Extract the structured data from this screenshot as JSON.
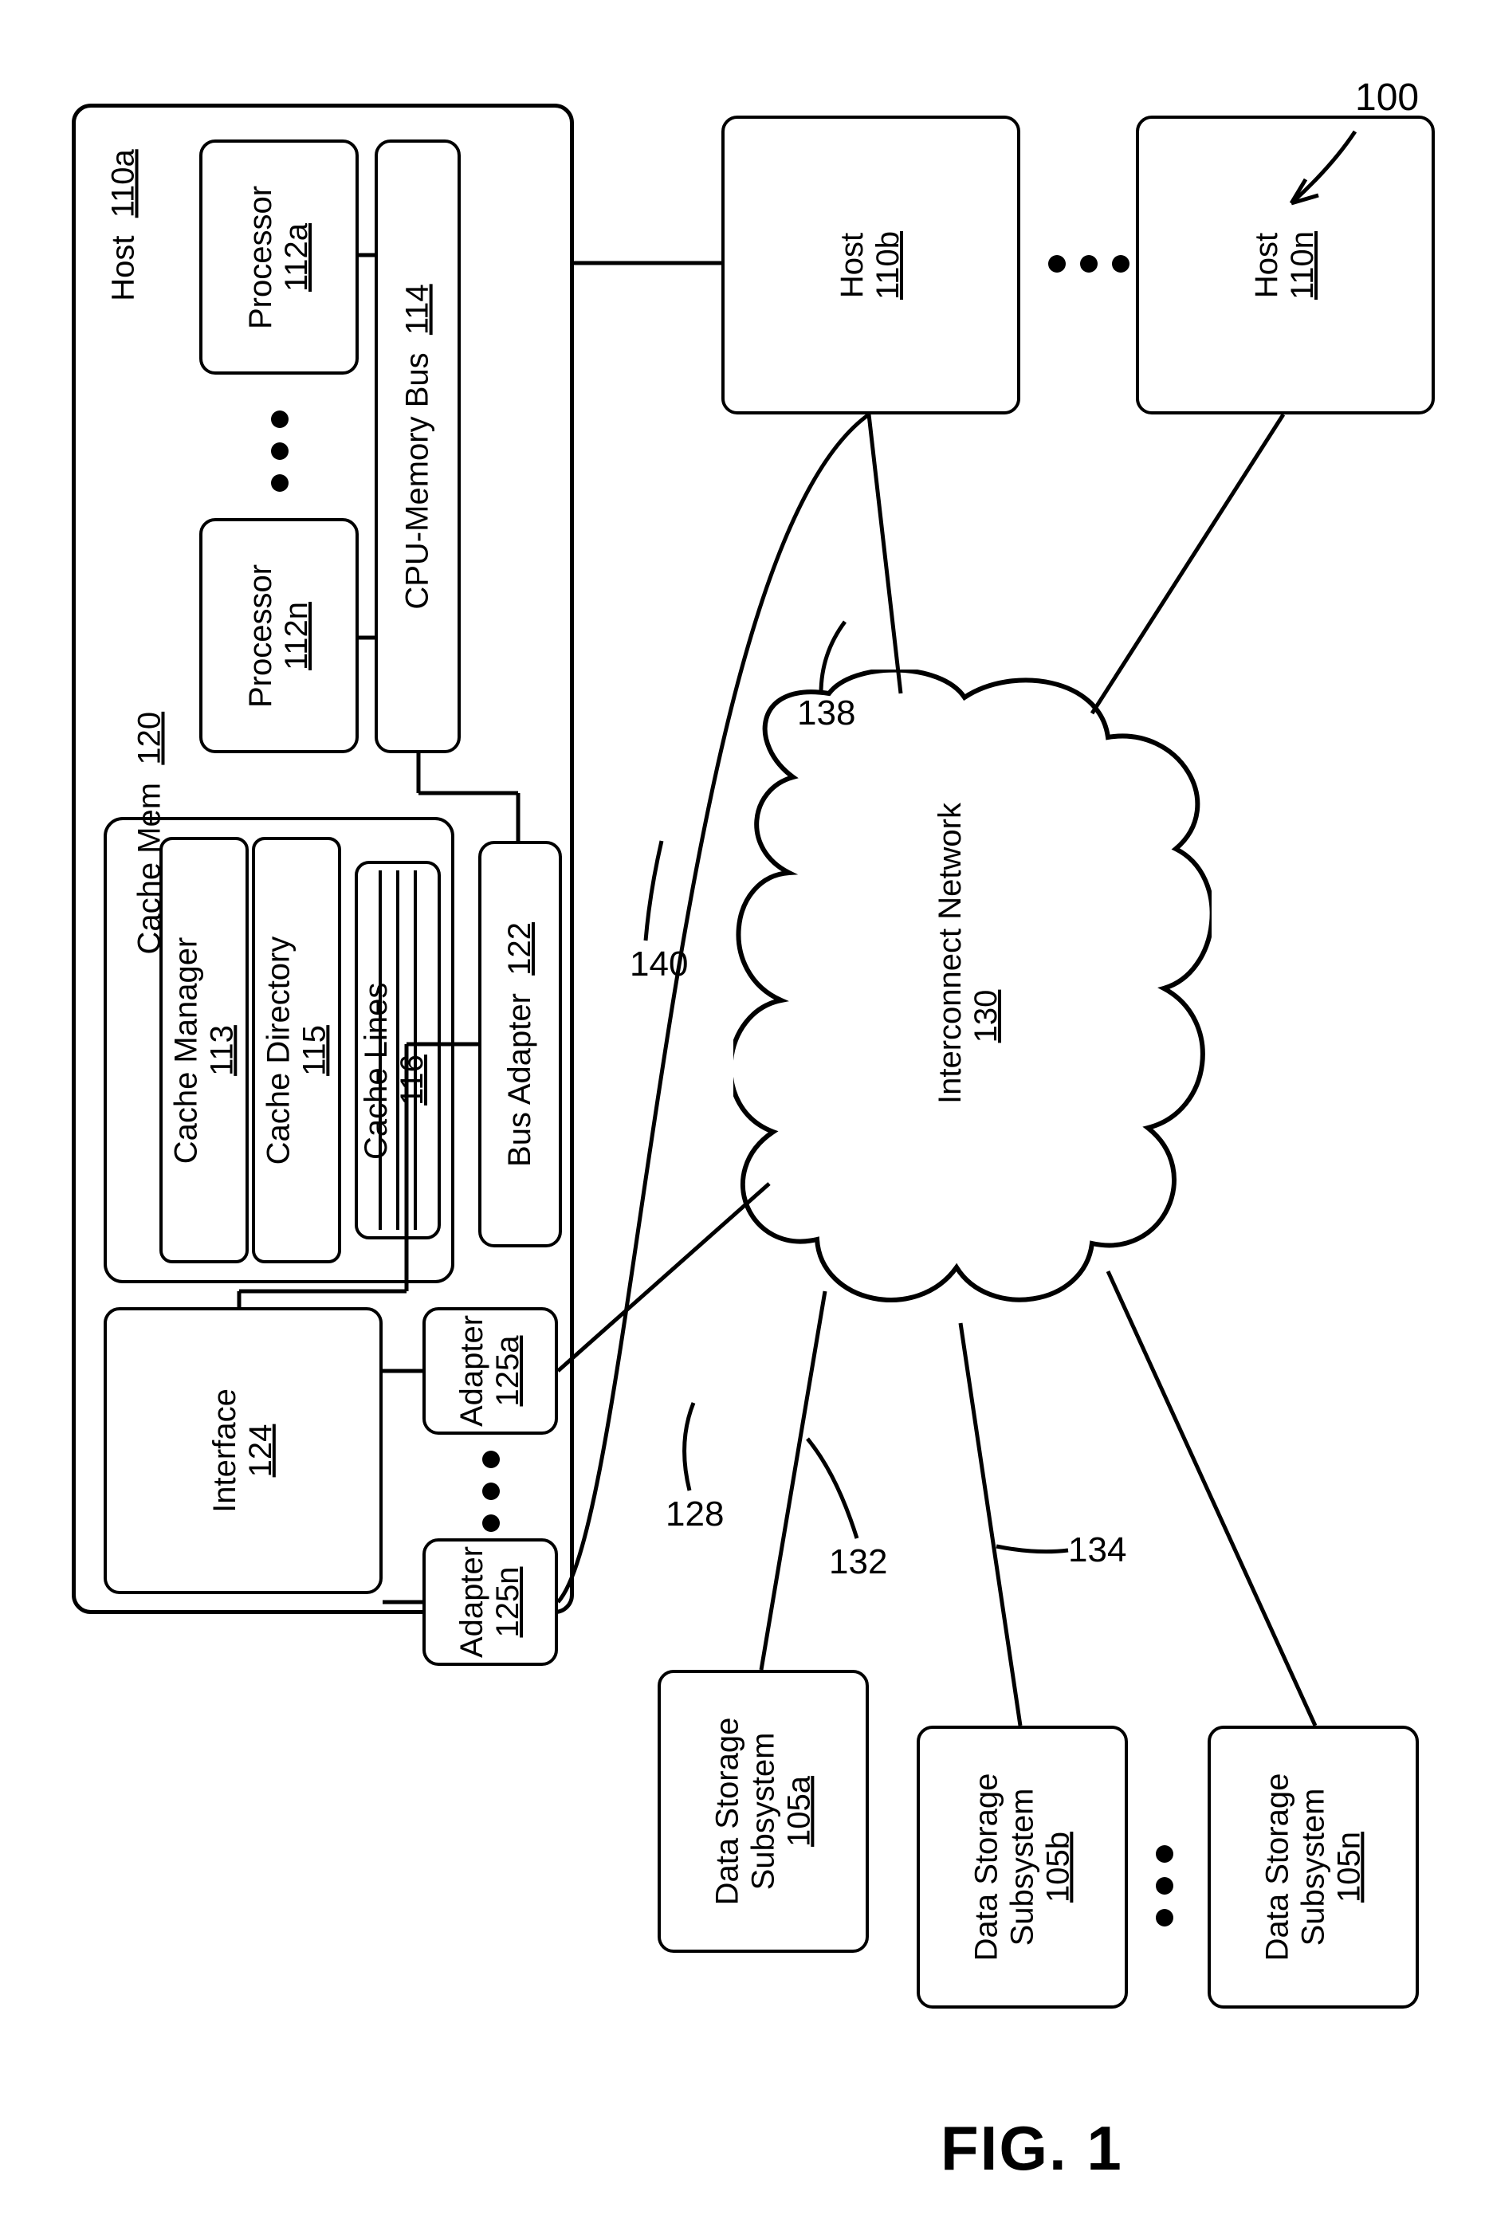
{
  "figure": {
    "caption": "FIG. 1",
    "ref": "100"
  },
  "host_detail": {
    "title": "Host",
    "id": "110a",
    "processor_a": {
      "label": "Processor",
      "id": "112a"
    },
    "processor_n": {
      "label": "Processor",
      "id": "112n"
    },
    "bus": {
      "label": "CPU-Memory Bus",
      "id": "114"
    },
    "cache_mem": {
      "label": "Cache Mem",
      "id": "120"
    },
    "cache_manager": {
      "label": "Cache Manager",
      "id": "113"
    },
    "cache_directory": {
      "label": "Cache Directory",
      "id": "115"
    },
    "cache_lines": {
      "label": "Cache Lines",
      "id": "116"
    },
    "bus_adapter": {
      "label": "Bus Adapter",
      "id": "122"
    },
    "interface": {
      "label": "Interface",
      "id": "124"
    },
    "adapter_a": {
      "label": "Adapter",
      "id": "125a"
    },
    "adapter_n": {
      "label": "Adapter",
      "id": "125n"
    }
  },
  "hosts": {
    "b": {
      "label": "Host",
      "id": "110b"
    },
    "n": {
      "label": "Host",
      "id": "110n"
    }
  },
  "network": {
    "label": "Interconnect Network",
    "id": "130"
  },
  "storage": {
    "a": {
      "label1": "Data Storage",
      "label2": "Subsystem",
      "id": "105a"
    },
    "b": {
      "label1": "Data Storage",
      "label2": "Subsystem",
      "id": "105b"
    },
    "n": {
      "label1": "Data Storage",
      "label2": "Subsystem",
      "id": "105n"
    }
  },
  "wire_refs": {
    "w140": "140",
    "w138": "138",
    "w128": "128",
    "w132": "132",
    "w134": "134"
  }
}
